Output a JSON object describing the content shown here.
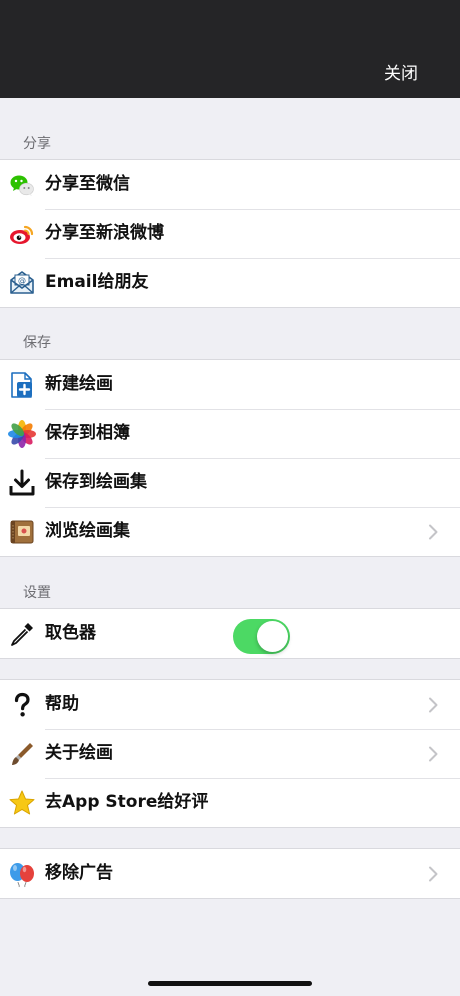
{
  "header": {
    "close_label": "关闭"
  },
  "sections": {
    "share": {
      "title": "分享",
      "items": [
        {
          "label": "分享至微信",
          "icon": "wechat-icon"
        },
        {
          "label": "分享至新浪微博",
          "icon": "weibo-icon"
        },
        {
          "label": "Email给朋友",
          "icon": "email-icon"
        }
      ]
    },
    "save": {
      "title": "保存",
      "items": [
        {
          "label": "新建绘画",
          "icon": "new-drawing-icon"
        },
        {
          "label": "保存到相簿",
          "icon": "photos-icon"
        },
        {
          "label": "保存到绘画集",
          "icon": "download-icon"
        },
        {
          "label": "浏览绘画集",
          "icon": "album-icon",
          "chevron": true
        }
      ]
    },
    "settings": {
      "title": "设置",
      "items": [
        {
          "label": "取色器",
          "icon": "eyedropper-icon",
          "toggle_on": true
        }
      ]
    },
    "about": {
      "items": [
        {
          "label": "帮助",
          "icon": "question-icon",
          "chevron": true
        },
        {
          "label": "关于绘画",
          "icon": "brush-icon",
          "chevron": true
        },
        {
          "label": "去App Store给好评",
          "icon": "star-icon"
        }
      ]
    },
    "ads": {
      "items": [
        {
          "label": "移除广告",
          "icon": "balloons-icon",
          "chevron": true
        }
      ]
    }
  },
  "colors": {
    "topbar": "#252527",
    "background": "#efeff4",
    "toggle_on": "#4cd964",
    "section_header": "#6d6d72"
  }
}
